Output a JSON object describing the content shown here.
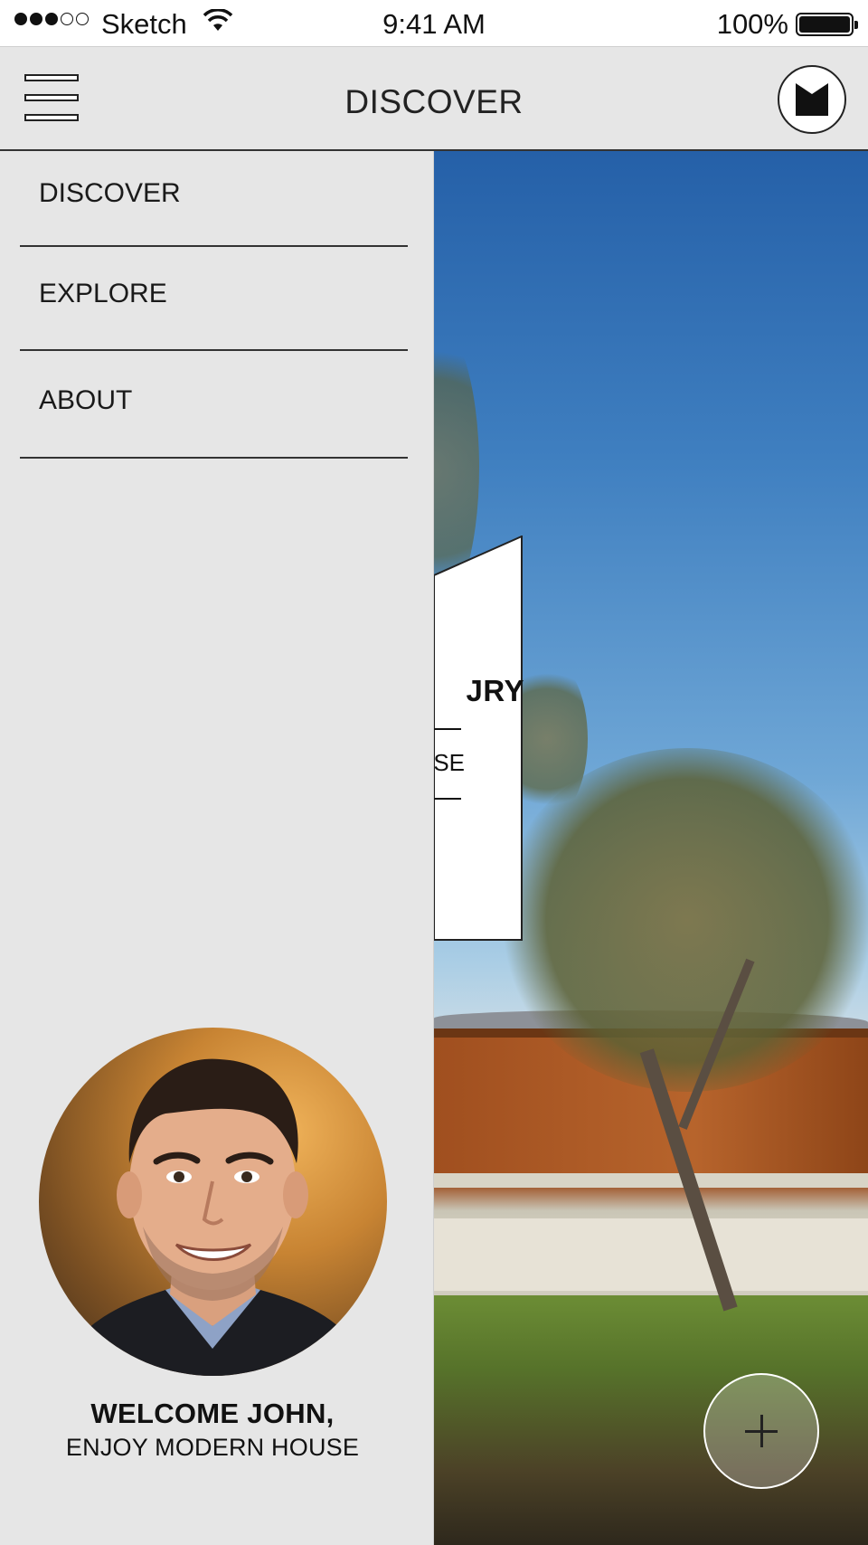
{
  "status_bar": {
    "carrier": "Sketch",
    "time": "9:41 AM",
    "battery": "100%",
    "signal_bars_filled": 3,
    "signal_bars_total": 5
  },
  "header": {
    "title": "DISCOVER",
    "menu_icon": "hamburger-menu-icon",
    "logo_icon": "brand-logo-icon"
  },
  "drawer": {
    "items": [
      {
        "label": "DISCOVER"
      },
      {
        "label": "EXPLORE"
      },
      {
        "label": "ABOUT"
      }
    ],
    "profile": {
      "welcome": "WELCOME JOHN,",
      "tagline": "ENJOY MODERN HOUSE"
    }
  },
  "card": {
    "title_fragment": "JRY",
    "subtitle_fragment": "SE"
  },
  "fab": {
    "icon": "plus-icon"
  },
  "colors": {
    "drawer_bg": "#e6e6e6",
    "header_bg": "#e6e6e6",
    "text": "#111111"
  }
}
